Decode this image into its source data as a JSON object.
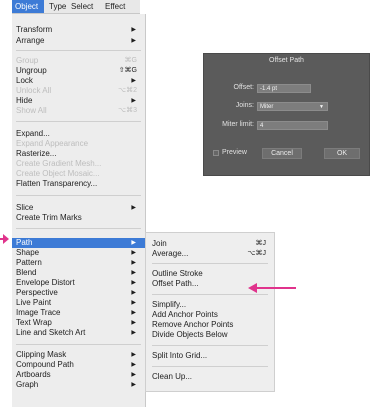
{
  "menubar": {
    "object": "Object",
    "type": "Type",
    "select": "Select",
    "effect": "Effect"
  },
  "object_menu": {
    "transform": "Transform",
    "arrange": "Arrange",
    "group": "Group",
    "group_sc": "⌘G",
    "ungroup": "Ungroup",
    "ungroup_sc": "⇧⌘G",
    "lock": "Lock",
    "unlock_all": "Unlock All",
    "unlock_all_sc": "⌥⌘2",
    "hide": "Hide",
    "show_all": "Show All",
    "show_all_sc": "⌥⌘3",
    "expand": "Expand...",
    "expand_appearance": "Expand Appearance",
    "rasterize": "Rasterize...",
    "create_gradient_mesh": "Create Gradient Mesh...",
    "create_object_mosaic": "Create Object Mosaic...",
    "flatten_transparency": "Flatten Transparency...",
    "slice": "Slice",
    "create_trim_marks": "Create Trim Marks",
    "path": "Path",
    "shape": "Shape",
    "pattern": "Pattern",
    "blend": "Blend",
    "envelope_distort": "Envelope Distort",
    "perspective": "Perspective",
    "live_paint": "Live Paint",
    "image_trace": "Image Trace",
    "text_wrap": "Text Wrap",
    "line_sketch": "Line and Sketch Art",
    "clipping_mask": "Clipping Mask",
    "compound_path": "Compound Path",
    "artboards": "Artboards",
    "graph": "Graph"
  },
  "path_submenu": {
    "join": "Join",
    "join_sc": "⌘J",
    "average": "Average...",
    "average_sc": "⌥⌘J",
    "outline_stroke": "Outline Stroke",
    "offset_path": "Offset Path...",
    "simplify": "Simplify...",
    "add_anchor_points": "Add Anchor Points",
    "remove_anchor_points": "Remove Anchor Points",
    "divide_objects_below": "Divide Objects Below",
    "split_into_grid": "Split Into Grid...",
    "clean_up": "Clean Up..."
  },
  "dialog": {
    "title": "Offset Path",
    "offset_label": "Offset:",
    "offset_value": "-1.4 pt",
    "joins_label": "Joins:",
    "joins_value": "Miter",
    "miter_label": "Miter limit:",
    "miter_value": "4",
    "preview": "Preview",
    "cancel": "Cancel",
    "ok": "OK"
  },
  "colors": {
    "highlight": "#3d7bd6",
    "arrow": "#e0338c",
    "dialog_bg": "#5b5b5b"
  }
}
